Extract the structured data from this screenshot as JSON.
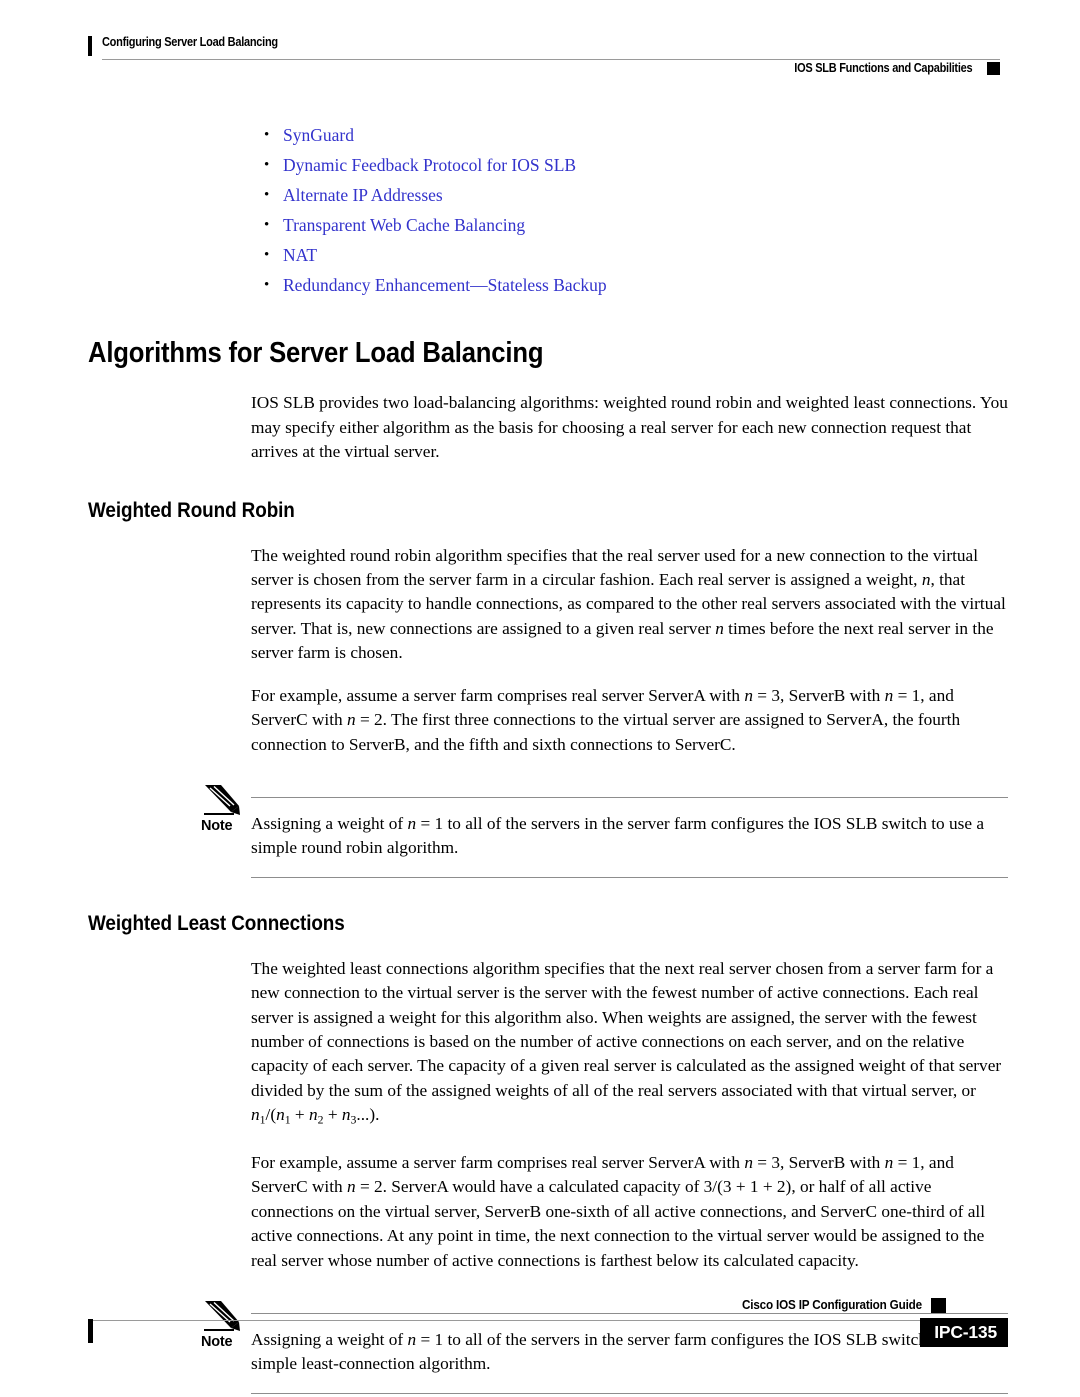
{
  "header": {
    "left_title": "Configuring Server Load Balancing",
    "right_title": "IOS SLB Functions and Capabilities",
    "marker_icon": "black-square-marker"
  },
  "link_list": {
    "bullet_glyph": "•",
    "link_color": "#3333CC",
    "items": [
      "SynGuard",
      "Dynamic Feedback Protocol for IOS SLB",
      "Alternate IP Addresses",
      "Transparent Web Cache Balancing",
      "NAT",
      "Redundancy Enhancement—Stateless Backup"
    ]
  },
  "main": {
    "chapter_heading": "Algorithms for Server Load Balancing",
    "intro_paragraph": "IOS SLB provides two load-balancing algorithms: weighted round robin and weighted least connections. You may specify either algorithm as the basis for choosing a real server for each new connection request that arrives at the virtual server.",
    "sections": [
      {
        "heading": "Weighted Round Robin",
        "paragraph_1_part_1": "The weighted round robin algorithm specifies that the real server used for a new connection to the virtual server is chosen from the server farm in a circular fashion. Each real server is assigned a weight, ",
        "paragraph_1_var_1": "n",
        "paragraph_1_part_2": ", that represents its capacity to handle connections, as compared to the other real servers associated with the virtual server. That is, new connections are assigned to a given real server ",
        "paragraph_1_var_2": "n",
        "paragraph_1_part_3": " times before the next real server in the server farm is chosen.",
        "paragraph_2_part_1": "For example, assume a server farm comprises real server ServerA with ",
        "paragraph_2_var_1": "n",
        "paragraph_2_part_2": " = 3, ServerB with ",
        "paragraph_2_var_2": "n",
        "paragraph_2_part_3": " = 1, and ServerC with ",
        "paragraph_2_var_3": "n",
        "paragraph_2_part_4": " = 2. The first three connections to the virtual server are assigned to ServerA, the fourth connection to ServerB, and the fifth and sixth connections to ServerC.",
        "note": {
          "label": "Note",
          "icon": "pencil-icon",
          "text_part_1": "Assigning a weight of ",
          "text_var": "n",
          "text_part_2": " = 1 to all of the servers in the server farm configures the IOS SLB switch to use a simple round robin algorithm."
        }
      },
      {
        "heading": "Weighted Least Connections",
        "paragraph_1_part_1": "The weighted least connections algorithm specifies that the next real server chosen from a server farm for a new connection to the virtual server is the server with the fewest number of active connections. Each real server is assigned a weight for this algorithm also. When weights are assigned, the server with the fewest number of connections is based on the number of active connections on each server, and on the relative capacity of each server. The capacity of a given real server is calculated as the assigned weight of that server divided by the sum of the assigned weights of all of the real servers associated with that virtual server, or ",
        "formula": {
          "var": "n",
          "sub_1": "1",
          "sep_1": "/(",
          "sub_2": "1",
          "op_1": " + ",
          "sub_3": "2",
          "op_2": " + ",
          "sub_4": "3",
          "tail": "...)."
        },
        "paragraph_2_part_1": "For example, assume a server farm comprises real server ServerA with ",
        "paragraph_2_var_1": "n",
        "paragraph_2_part_2": " = 3, ServerB with ",
        "paragraph_2_var_2": "n",
        "paragraph_2_part_3": " = 1, and ServerC with ",
        "paragraph_2_var_3": "n",
        "paragraph_2_part_4": " = 2. ServerA would have a calculated capacity of 3/(3 + 1 + 2), or half of all active connections on the virtual server, ServerB one-sixth of all active connections, and ServerC one-third of all active connections. At any point in time, the next connection to the virtual server would be assigned to the real server whose number of active connections is farthest below its calculated capacity.",
        "note": {
          "label": "Note",
          "icon": "pencil-icon",
          "text_part_1": "Assigning a weight of ",
          "text_var": "n",
          "text_part_2": " = 1 to all of the servers in the server farm configures the IOS SLB switch to use a simple least-connection algorithm."
        }
      }
    ]
  },
  "footer": {
    "guide_title": "Cisco IOS IP Configuration Guide",
    "page_number": "IPC-135",
    "marker_icon": "black-square-marker"
  }
}
